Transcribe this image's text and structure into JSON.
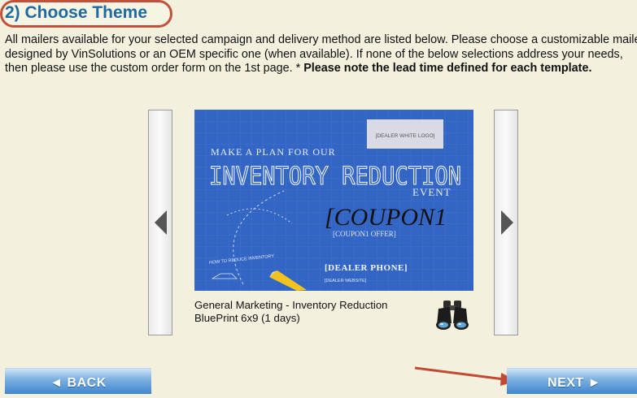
{
  "section": {
    "title": "2) Choose Theme"
  },
  "intro": {
    "text": "All mailers available for your selected campaign and delivery method are listed below. Please choose a customizable mailer designed by VinSolutions or an OEM specific one (when available). If none of the below selections address your needs, then please use the custom order form on the 1st page. * ",
    "bold_note": "Please note the lead time defined for each template."
  },
  "carousel": {
    "prev_icon": "triangle-left-icon",
    "next_icon": "triangle-right-icon",
    "thumbnail": {
      "logo_box": "[DEALER WHITE LOGO]",
      "headline_small": "MAKE A PLAN FOR OUR",
      "headline_big": "INVENTORY REDUCTION",
      "event": "EVENT",
      "coupon": "[COUPON1",
      "coupon_offer": "[COUPON1 OFFER]",
      "dealer_phone": "[DEALER PHONE]",
      "dealer_website": "[DEALER WEBSITE]",
      "sketch_note": "HOW TO REDUCE INVENTORY"
    },
    "caption_line1": "General Marketing - Inventory Reduction",
    "caption_line2": "BluePrint 6x9 (1 days)",
    "preview_icon": "binoculars-icon"
  },
  "buttons": {
    "back": "◄ BACK",
    "next": "NEXT ►"
  },
  "colors": {
    "background": "#f3f1dd",
    "title": "#1f6aa0",
    "highlight": "#c2513b",
    "blueprint": "#3264c2"
  }
}
